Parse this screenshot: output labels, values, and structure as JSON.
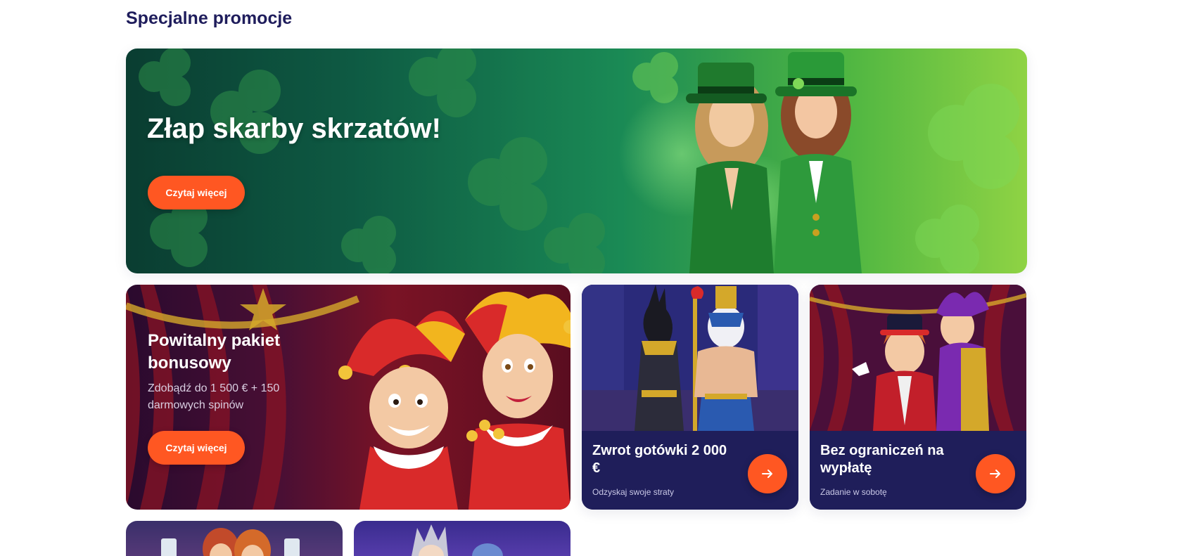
{
  "section": {
    "title": "Specjalne promocje"
  },
  "hero": {
    "title": "Złap skarby skrzatów!",
    "cta_label": "Czytaj więcej",
    "art_icon": "leprechaun-women-illustration"
  },
  "welcome": {
    "title": "Powitalny pakiet bonusowy",
    "description": "Zdobądź do 1 500 € + 150 darmowych spinów",
    "cta_label": "Czytaj więcej",
    "art_icon": "jesters-illustration"
  },
  "cards": [
    {
      "title": "Zwrot gotówki 2 000 €",
      "subtitle": "Odzyskaj swoje straty",
      "art_icon": "egyptian-gods-illustration",
      "button_icon": "arrow-right-icon"
    },
    {
      "title": "Bez ograniczeń na wypłatę",
      "subtitle": "Zadanie w sobotę",
      "art_icon": "harlequin-couple-illustration",
      "button_icon": "arrow-right-icon"
    }
  ],
  "colors": {
    "accent": "#ff5722",
    "heading": "#1f1d5c",
    "card_footer": "#1f1e5a"
  }
}
